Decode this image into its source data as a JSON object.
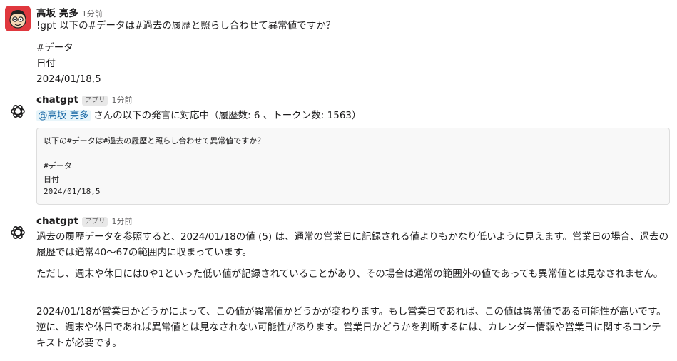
{
  "messages": [
    {
      "author": "高坂 亮多",
      "time": "1分前",
      "lines": [
        "!gpt 以下の#データは#過去の履歴と照らし合わせて異常値ですか？",
        "#データ",
        "日付",
        "2024/01/18,5"
      ]
    },
    {
      "author": "chatgpt",
      "badge": "アプリ",
      "time": "1分前",
      "mention": "@高坂 亮多",
      "status": " さんの以下の発言に対応中（履歴数: 6 、トークン数: 1563）",
      "code_lines": [
        "以下の#データは#過去の履歴と照らし合わせて異常値ですか？",
        "#データ",
        "日付",
        "2024/01/18,5"
      ]
    },
    {
      "author": "chatgpt",
      "badge": "アプリ",
      "time": "1分前",
      "paragraphs": [
        "過去の履歴データを参照すると、2024/01/18の値 (5) は、通常の営業日に記録される値よりもかなり低いように見えます。営業日の場合、過去の履歴では通常40〜67の範囲内に収まっています。",
        "ただし、週末や休日には0や1といった低い値が記録されていることがあり、その場合は通常の範囲外の値であっても異常値とは見なされません。",
        "2024/01/18が営業日かどうかによって、この値が異常値かどうかが変わります。もし営業日であれば、この値は異常値である可能性が高いです。逆に、週末や休日であれば異常値とは見なされない可能性があります。営業日かどうかを判断するには、カレンダー情報や営業日に関するコンテキストが必要です。"
      ]
    }
  ],
  "icons": {
    "user_avatar": "cartoon-face-avatar",
    "bot_avatar": "openai-logo-icon"
  },
  "colors": {
    "mention_bg": "#e8f5fa",
    "mention_text": "#1264a3",
    "avatar_red": "#e0383e"
  }
}
